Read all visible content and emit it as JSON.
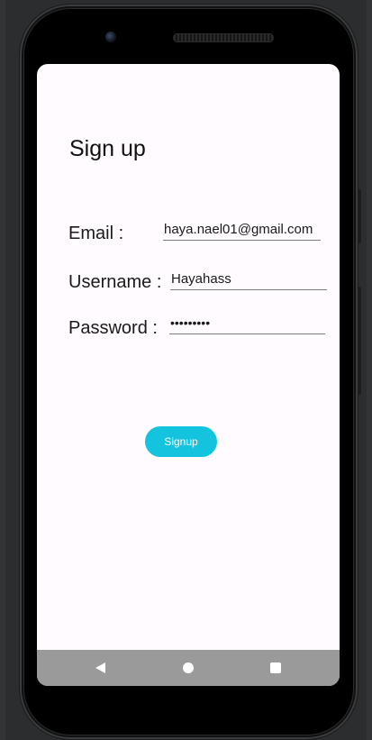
{
  "screen": {
    "title": "Sign up"
  },
  "form": {
    "email_label": "Email :",
    "email_value": "haya.nael01@gmail.com",
    "username_label": "Username :",
    "username_value": "Hayahass",
    "password_label": "Password :",
    "password_value": "•••••••••"
  },
  "actions": {
    "signup_label": "Signup"
  },
  "navigation": {
    "back_icon": "back-triangle-icon",
    "home_icon": "home-circle-icon",
    "recents_icon": "recents-square-icon"
  },
  "colors": {
    "accent": "#14c3de",
    "background": "#fffbfe",
    "nav_bar": "#9a9a9a"
  }
}
